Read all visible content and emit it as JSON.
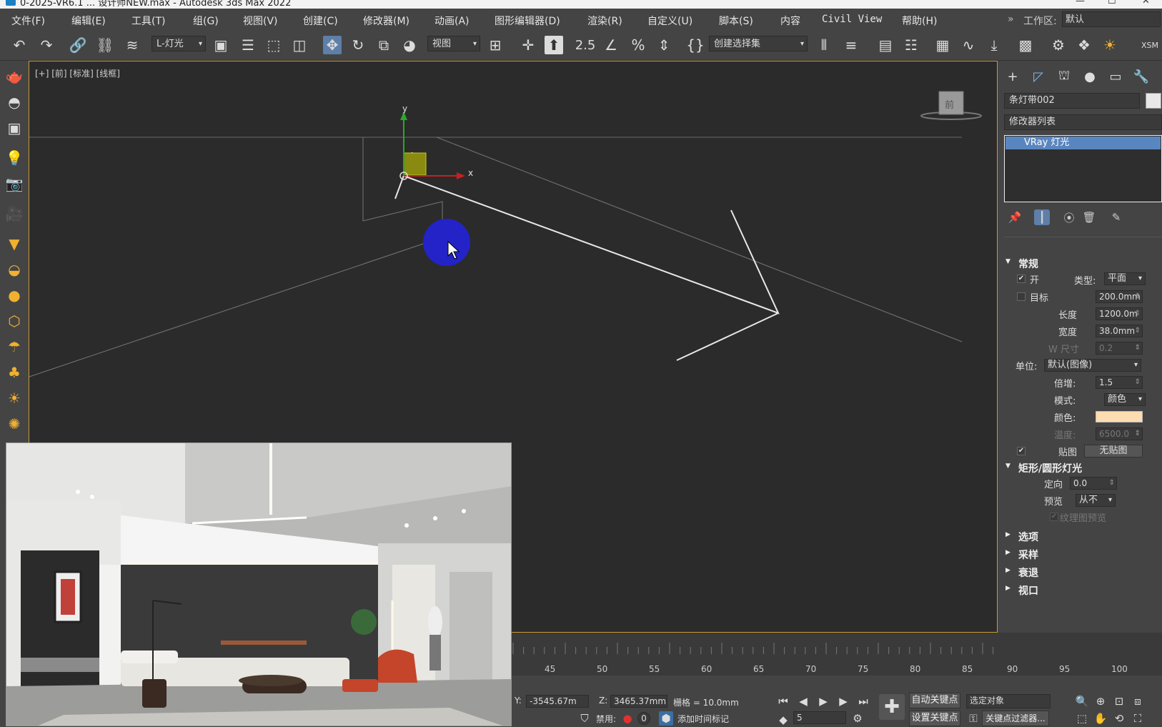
{
  "title_bar": {
    "title": "0-2025-VR6.1 ... 设计师NEW.max - Autodesk 3ds Max 2022"
  },
  "menu": {
    "items": [
      "文件(F)",
      "编辑(E)",
      "工具(T)",
      "组(G)",
      "视图(V)",
      "创建(C)",
      "修改器(M)",
      "动画(A)",
      "图形编辑器(D)",
      "渲染(R)",
      "自定义(U)",
      "脚本(S)",
      "内容",
      "Civil View",
      "帮助(H)"
    ],
    "workspace_label": "工作区:",
    "workspace_value": "默认"
  },
  "toolbar": {
    "selection_filter": "L-灯光",
    "ref_coord": "视图",
    "selection_set": "创建选择集",
    "angle_snap_value": "2.5",
    "xsm_label": "XSM"
  },
  "viewport": {
    "label": "[+] [前] [标准] [线框]",
    "axis_x": "x",
    "axis_y": "y",
    "viewcube_label": "前"
  },
  "command_panel": {
    "object_name": "条灯带002",
    "modifier_list": "修改器列表",
    "stack_item": "VRay 灯光",
    "rollouts": {
      "general": {
        "title": "常规",
        "on_label": "开",
        "type_label": "类型:",
        "type_value": "平面",
        "target_label": "目标",
        "target_value": "200.0mm",
        "length_label": "长度",
        "length_value": "1200.0m",
        "width_label": "宽度",
        "width_value": "38.0mm",
        "wsize_label": "W 尺寸",
        "wsize_value": "0.2",
        "units_label": "单位:",
        "units_value": "默认(图像)",
        "multiplier_label": "倍增:",
        "multiplier_value": "1.5",
        "mode_label": "模式:",
        "mode_value": "颜色",
        "color_label": "颜色:",
        "temperature_label": "温度:",
        "temperature_value": "6500.0",
        "texture_label": "贴图",
        "texture_value": "无贴图"
      },
      "rect_disc": {
        "title": "矩形/圆形灯光",
        "directional_label": "定向",
        "directional_value": "0.0",
        "preview_label": "预览",
        "preview_value": "从不",
        "tex_preview_label": "纹理图预览"
      },
      "options": {
        "title": "选项"
      },
      "sampling": {
        "title": "采样"
      },
      "decay": {
        "title": "衰退"
      },
      "viewport": {
        "title": "视口"
      }
    },
    "light_color": "#fcdcb0"
  },
  "timeline": {
    "ticks": [
      "45",
      "50",
      "55",
      "60",
      "65",
      "70",
      "75",
      "80",
      "85",
      "90",
      "95",
      "100"
    ]
  },
  "status": {
    "y_label": "Y:",
    "y_value": "-3545.67m",
    "z_label": "Z:",
    "z_value": "3465.37mm",
    "grid_label": "栅格 = 10.0mm",
    "auto_key": "自动关键点",
    "selected": "选定对象",
    "set_key": "设置关键点",
    "key_filters": "关键点过滤器...",
    "disabled_label": "禁用:",
    "disabled_count": "0",
    "add_time_tag": "添加时间标记",
    "frame_value": "5"
  },
  "colors": {
    "viewport_bg": "#2b2b2b",
    "viewport_border": "#c89a30",
    "stack_selection": "#5a86bf",
    "cursor_highlight": "#2323c8"
  }
}
